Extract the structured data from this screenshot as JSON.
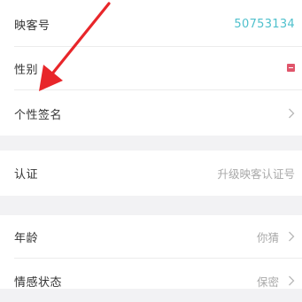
{
  "profile": {
    "yingke_id": {
      "label": "映客号",
      "value": "50753134"
    },
    "gender": {
      "label": "性别"
    },
    "signature": {
      "label": "个性签名"
    }
  },
  "verification": {
    "label": "认证",
    "value": "升级映客认证号"
  },
  "details": {
    "age": {
      "label": "年龄",
      "value": "你猜"
    },
    "relationship": {
      "label": "情感状态",
      "value": "保密"
    }
  },
  "colors": {
    "accent": "#4fc0cc",
    "gender_badge": "#e0556b",
    "annotation_arrow": "#e8262a",
    "background": "#f2f2f4"
  },
  "icons": {
    "chevron": "chevron-right-icon",
    "gender": "female-gender-icon",
    "arrow": "annotation-arrow"
  }
}
